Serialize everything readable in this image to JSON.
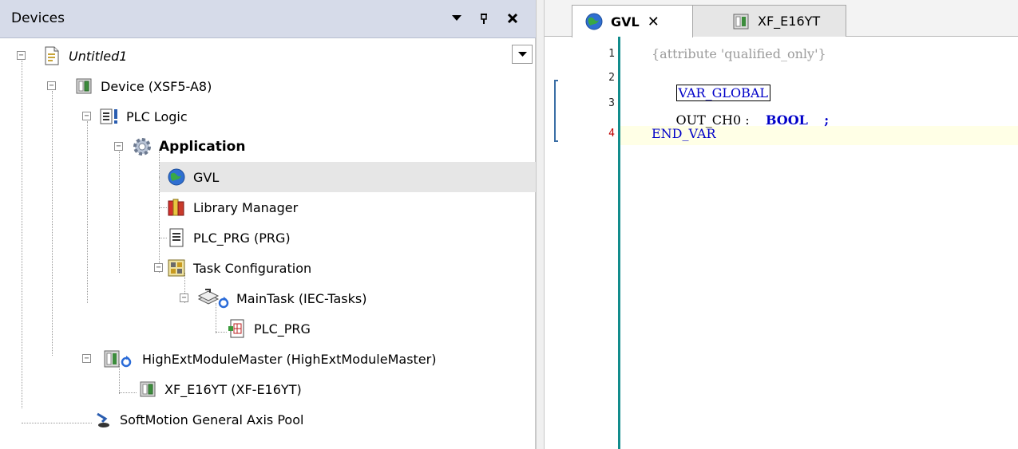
{
  "devices_panel": {
    "title": "Devices",
    "pin_glyph": "ᵽ"
  },
  "tree": {
    "project": "Untitled1",
    "device": "Device (XSF5-A8)",
    "plc_logic": "PLC Logic",
    "application": "Application",
    "gvl": "GVL",
    "library_manager": "Library Manager",
    "plc_prg_pou": "PLC_PRG (PRG)",
    "task_configuration": "Task Configuration",
    "main_task": "MainTask (IEC-Tasks)",
    "plc_prg_call": "PLC_PRG",
    "high_ext_master": "HighExtModuleMaster (HighExtModuleMaster)",
    "xf_e16yt": "XF_E16YT (XF-E16YT)",
    "softmotion": "SoftMotion General Axis Pool"
  },
  "editor": {
    "tabs": [
      {
        "label": "GVL",
        "active": true
      },
      {
        "label": "XF_E16YT",
        "active": false
      }
    ],
    "line_numbers": [
      "1",
      "2",
      "3",
      "4"
    ],
    "code": {
      "line1": "{attribute 'qualified_only'}",
      "line2": "VAR_GLOBAL",
      "line3_var": "OUT_CH0 :",
      "line3_type": "BOOL",
      "line3_end": ";",
      "line4": "END_VAR"
    }
  },
  "colors": {
    "header_bg": "#d6dbe9",
    "selected_row": "#e6e6e6",
    "gutter_bar": "#128c8c",
    "keyword": "#0000c8",
    "comment": "#9b9b9b",
    "current_line_number": "#c00000"
  }
}
